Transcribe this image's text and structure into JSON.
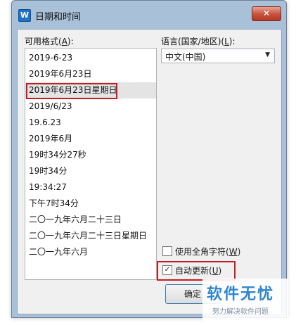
{
  "window": {
    "title": "日期和时间",
    "icon_glyph": "W",
    "close_glyph": "✕",
    "app_icon": "wps-writer-icon"
  },
  "formats": {
    "label_prefix": "可用格式(",
    "label_key": "A",
    "label_suffix": "):",
    "items": [
      "2019-6-23",
      "2019年6月23日",
      "2019年6月23日星期日",
      "2019/6/23",
      "19.6.23",
      "2019年6月",
      "19时34分27秒",
      "19时34分",
      "19:34:27",
      "下午7时34分",
      "二〇一九年六月二十三日",
      "二〇一九年六月二十三日星期日",
      "二〇一九年六月"
    ],
    "selected_index": 2
  },
  "language": {
    "label_prefix": "语言(国家/地区)(",
    "label_key": "L",
    "label_suffix": "):",
    "value": "中文(中国)",
    "arrow_glyph": "▼"
  },
  "fullwidth": {
    "label_prefix": "使用全角字符(",
    "label_key": "W",
    "label_suffix": ")",
    "checked": false,
    "mark": ""
  },
  "autoupdate": {
    "label_prefix": "自动更新(",
    "label_key": "U",
    "label_suffix": ")",
    "checked": true,
    "mark": "✓"
  },
  "buttons": {
    "ok": "确定"
  },
  "watermark": {
    "title": "软件无忧",
    "subtitle": "努力解决软件问题"
  },
  "colors": {
    "highlight": "#c41e24",
    "watermark": "#2f86cf",
    "selection": "#e4e4e4"
  }
}
